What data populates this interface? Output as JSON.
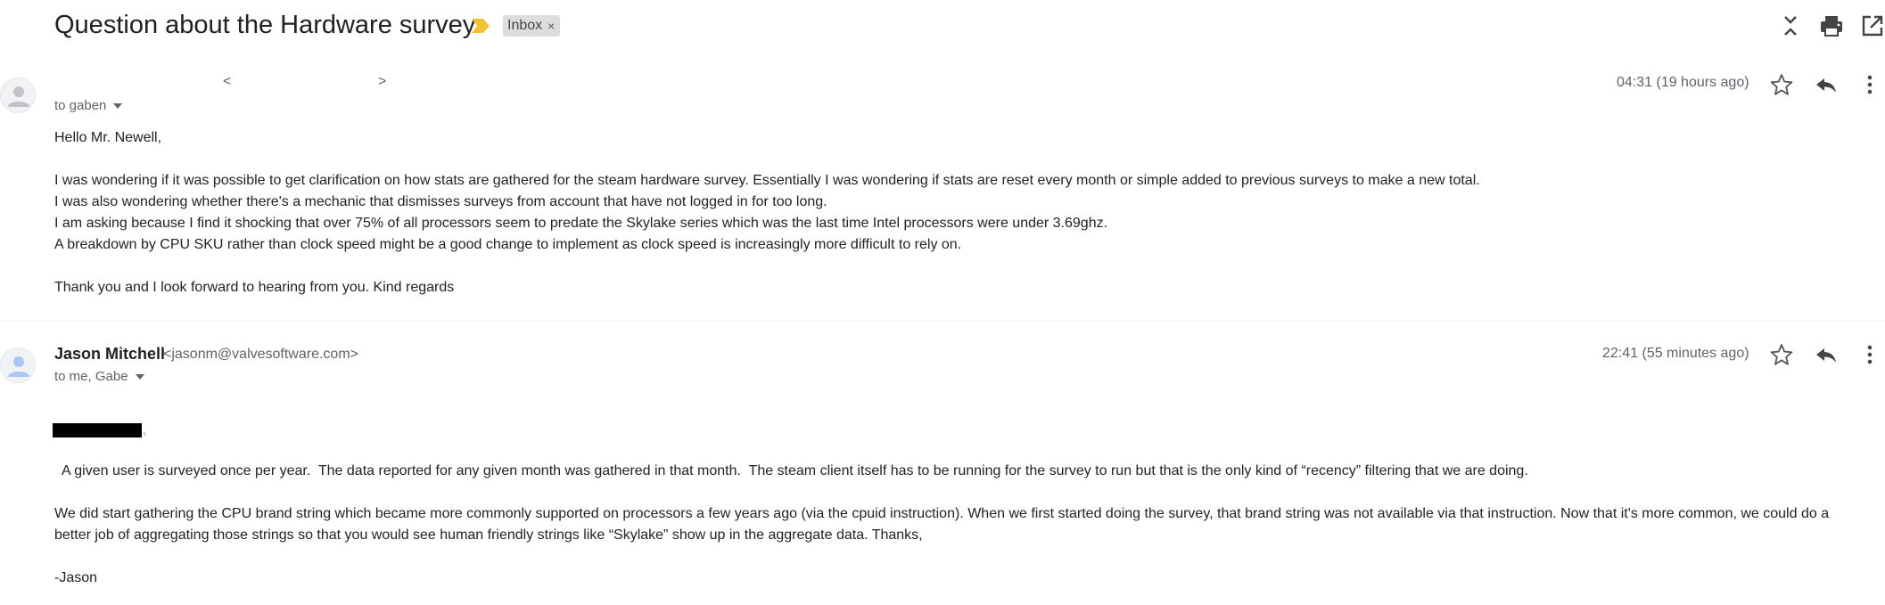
{
  "thread": {
    "subject": "Question about the Hardware survey",
    "label": "Inbox",
    "label_close_glyph": "×",
    "important_color": "#f4c430"
  },
  "toolbar": {
    "icons": [
      "collapse-all-icon",
      "print-icon",
      "open-in-new-window-icon"
    ]
  },
  "messages": [
    {
      "sender_name": "",
      "sender_email_open": "<",
      "sender_email_close": ">",
      "recipients": "to gaben",
      "timestamp": "04:31 (19 hours ago)",
      "body": {
        "greeting": "Hello Mr. Newell,",
        "lines": [
          "I was wondering if it was possible to get clarification on how stats are gathered for the steam hardware survey. Essentially I was wondering if stats are reset every month or simple added to previous surveys to make a new total.",
          "I was also wondering whether there's a mechanic that dismisses surveys from account that have not logged in for too long.",
          "I am asking because I find it shocking that over 75% of all processors seem to predate the Skylake series which was the last time Intel processors were under 3.69ghz.",
          "A breakdown by CPU SKU rather than clock speed might be a good change to implement as clock speed is increasingly more difficult to rely on."
        ],
        "closing": "Thank you and I look forward to hearing from you. Kind regards"
      }
    },
    {
      "sender_name": "Jason Mitchell",
      "sender_email": "<jasonm@valvesoftware.com>",
      "recipients": "to me, Gabe",
      "timestamp": "22:41 (55 minutes ago)",
      "body": {
        "redacted_suffix": ",",
        "paragraph1": "  A given user is surveyed once per year.  The data reported for any given month was gathered in that month.  The steam client itself has to be running for the survey to run but that is the only kind of “recency” filtering that we are doing.",
        "paragraph2_line1": "We did start gathering the CPU brand string which became more commonly supported on processors a few years ago (via the cpuid instruction). When we first started doing the survey, that brand string was not available via that instruction. Now that it's more common, we could do a",
        "paragraph2_line2": "better job of aggregating those strings so that you would see human friendly strings like “Skylake” show up in the aggregate data.  Thanks,",
        "signature": "-Jason"
      }
    }
  ]
}
